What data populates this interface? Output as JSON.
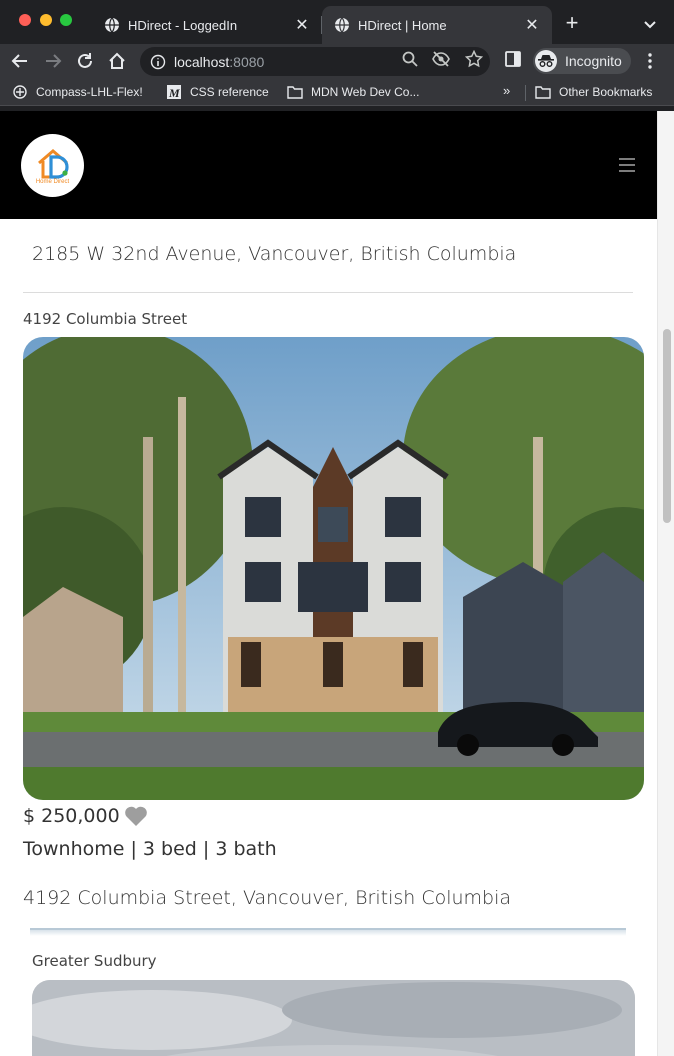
{
  "browser": {
    "tabs": [
      {
        "title": "HDirect - LoggedIn",
        "active": false
      },
      {
        "title": "HDirect | Home",
        "active": true
      }
    ],
    "new_tab_label": "+",
    "url_host": "localhost",
    "url_port": ":8080",
    "profile_label": "Incognito",
    "bookmarks": [
      {
        "label": "Compass-LHL-Flex!",
        "icon": "compass-icon"
      },
      {
        "label": "CSS reference",
        "icon": "mdn-icon"
      },
      {
        "label": "MDN Web Dev Co...",
        "icon": "folder-icon"
      }
    ],
    "bookmarks_overflow": "»",
    "other_bookmarks": "Other Bookmarks"
  },
  "site": {
    "logo_text": "Home Direct",
    "brand_colors": {
      "orange": "#f08a24",
      "blue": "#2f8fd6",
      "green": "#3cb043"
    }
  },
  "listings": {
    "previous_title_partial": "~~~~ ~~~~ ~~~~",
    "previous_address": "2185 W 32nd Avenue, Vancouver, British Columbia",
    "current": {
      "title": "4192 Columbia Street",
      "price": "$ 250,000",
      "specs": "Townhome | 3 bed | 3 bath",
      "address": "4192 Columbia Street, Vancouver, British Columbia"
    },
    "next": {
      "title": "Greater Sudbury"
    }
  }
}
